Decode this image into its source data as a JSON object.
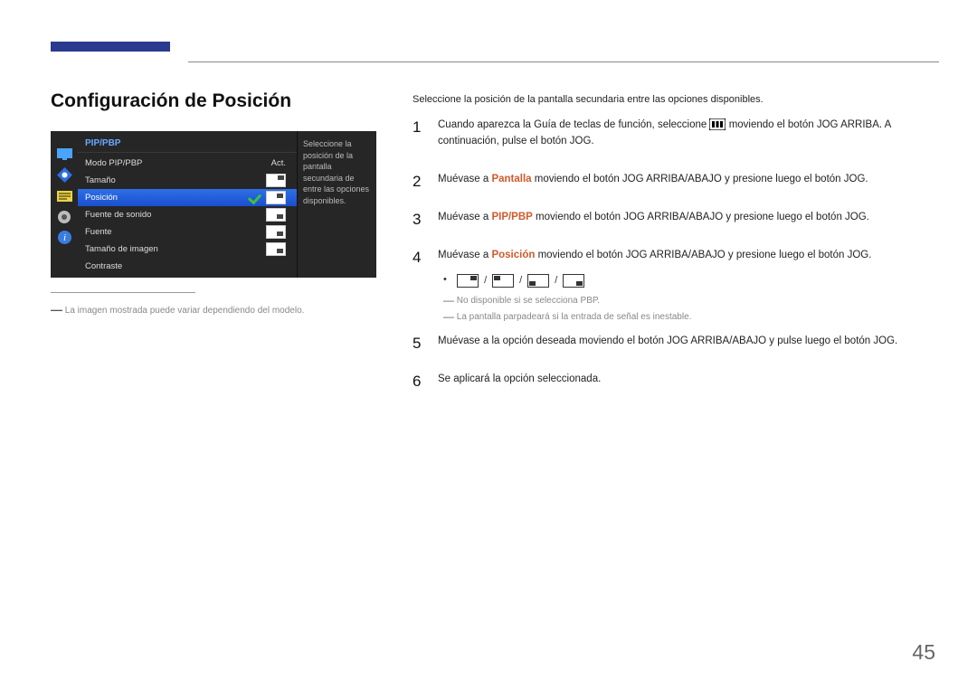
{
  "page": {
    "title": "Configuración de Posición",
    "number": "45"
  },
  "osd": {
    "header": "PIP/PBP",
    "items": [
      {
        "label": "Modo PIP/PBP",
        "value": "Act."
      },
      {
        "label": "Tamaño",
        "value": ""
      },
      {
        "label": "Posición",
        "value": "",
        "selected": true
      },
      {
        "label": "Fuente de sonido",
        "value": ""
      },
      {
        "label": "Fuente",
        "value": ""
      },
      {
        "label": "Tamaño de imagen",
        "value": ""
      },
      {
        "label": "Contraste",
        "value": ""
      }
    ],
    "side_text": "Seleccione la posición de la pantalla secundaria de entre las opciones disponibles."
  },
  "footnote": "La imagen mostrada puede variar dependiendo del modelo.",
  "intro": "Seleccione la posición de la pantalla secundaria entre las opciones disponibles.",
  "steps": {
    "s1a": "Cuando aparezca la Guía de teclas de función, seleccione ",
    "s1b": " moviendo el botón JOG ARRIBA. A continuación, pulse el botón JOG.",
    "s2": {
      "pre": "Muévase a ",
      "hl": "Pantalla",
      "post": " moviendo el botón JOG ARRIBA/ABAJO y presione luego el botón JOG."
    },
    "s3": {
      "pre": "Muévase a ",
      "hl": "PIP/PBP",
      "post": " moviendo el botón JOG ARRIBA/ABAJO y presione luego el botón JOG."
    },
    "s4": {
      "pre": "Muévase a ",
      "hl": "Posición",
      "post": " moviendo el botón JOG ARRIBA/ABAJO y presione luego el botón JOG."
    },
    "note1": "No disponible si se selecciona PBP.",
    "note2": "La pantalla parpadeará si la entrada de señal es inestable.",
    "s5": "Muévase a la opción deseada moviendo el botón JOG ARRIBA/ABAJO y pulse luego el botón JOG.",
    "s6": "Se aplicará la opción seleccionada."
  },
  "labels": {
    "sep": " / "
  }
}
